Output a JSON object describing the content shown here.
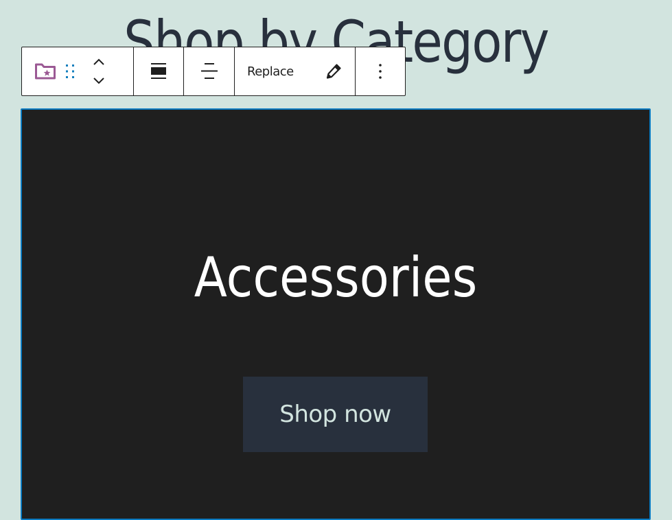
{
  "page": {
    "heading": "Shop by Category",
    "background_color": "#d2e4df",
    "text_color": "#28303d"
  },
  "toolbar": {
    "block_icon": "folder-star-icon",
    "block_icon_color": "#9b5994",
    "drag_icon": "drag-handle-icon",
    "drag_icon_color": "#137fbd",
    "move_up_icon": "chevron-up-icon",
    "move_down_icon": "chevron-down-icon",
    "align_icon": "align-full-width-icon",
    "vertical_align_icon": "align-vertical-center-icon",
    "replace_label": "Replace",
    "edit_icon": "pencil-icon",
    "more_icon": "more-vertical-icon"
  },
  "cover": {
    "title": "Accessories",
    "button_label": "Shop now",
    "background_color": "#1f1f1f",
    "selected_border_color": "#0a7ac1",
    "button_background": "#28303d",
    "button_text_color": "#d2e4df"
  }
}
